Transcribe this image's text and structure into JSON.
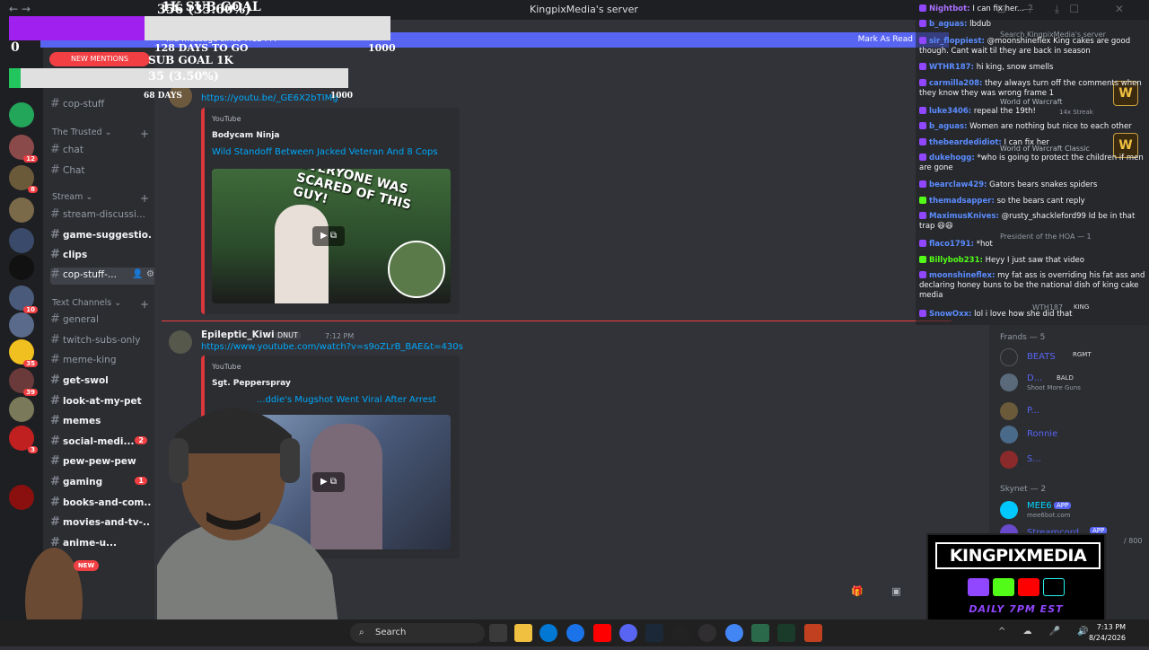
{
  "window": {
    "title": "KingpixMedia's server",
    "nav": "← →",
    "window_controls": "— ☐ ✕",
    "title_icons": "⊟ ? ⤓"
  },
  "sub_goal_1": {
    "title": "1K SUB GOAL",
    "progress_text": "356 (35.60%)",
    "progress_fraction": 0.356,
    "days_to_go": "128 DAYS TO GO",
    "max": "1000",
    "zero": "0"
  },
  "sub_goal_2": {
    "title": "SUB GOAL 1K",
    "progress_text": "35 (3.50%)",
    "progress_fraction": 0.035,
    "days": "68 DAYS",
    "max": "1000"
  },
  "banner": {
    "new_mentions": "NEW MENTIONS",
    "text": "...d message since 7:12 PM",
    "mark_as_read": "Mark As Read"
  },
  "channels": {
    "top": {
      "label": "cop-stuff"
    },
    "cat_trusted": "The Trusted",
    "trusted": [
      {
        "label": "chat"
      },
      {
        "label": "Chat"
      }
    ],
    "cat_stream": "Stream",
    "stream": [
      {
        "label": "stream-discussi..."
      },
      {
        "label": "game-suggestio..."
      },
      {
        "label": "clips"
      },
      {
        "label": "cop-stuff-..."
      }
    ],
    "cat_text": "Text Channels",
    "text": [
      {
        "label": "general"
      },
      {
        "label": "twitch-subs-only"
      },
      {
        "label": "meme-king"
      },
      {
        "label": "get-swol"
      },
      {
        "label": "look-at-my-pet"
      },
      {
        "label": "memes"
      },
      {
        "label": "social-medi...",
        "badge": "2"
      },
      {
        "label": "pew-pew-pew"
      },
      {
        "label": "gaming",
        "badge": "1"
      },
      {
        "label": "books-and-com..."
      },
      {
        "label": "movies-and-tv-..."
      },
      {
        "label": "anime-u..."
      }
    ],
    "new_pill": "NEW"
  },
  "server_badges": [
    "12",
    "8",
    "10",
    "35",
    "39",
    "3"
  ],
  "messages": [
    {
      "link": "https://youtu.be/_GE6X2bTIMg",
      "embed": {
        "provider": "YouTube",
        "author": "Bodycam Ninja",
        "title": "Wild Standoff Between Jacked Veteran And 8 Cops",
        "thumb_text": "EVERYONE WAS SCARED OF THIS GUY!"
      }
    },
    {
      "author": "Epileptic_Kiwi",
      "tag": "DNUT",
      "time": "7:12 PM",
      "link": "https://www.youtube.com/watch?v=s9oZLrB_BAE&t=430s",
      "embed": {
        "provider": "YouTube",
        "author": "Sgt. Pepperspray",
        "title": "...ddie's Mugshot Went Viral After Arrest"
      }
    }
  ],
  "chat": [
    {
      "user": "Nightbot:",
      "text": "I can fix her...",
      "color": "#a970ff"
    },
    {
      "user": "b_aguas:",
      "text": "lbdub",
      "color": "#5b8cff"
    },
    {
      "user": "sir_floppiest:",
      "text": "@moonshineflex King cakes are good though. Cant wait til they are back in season",
      "color": "#5b8cff"
    },
    {
      "user": "WTHR187:",
      "text": "hi king, snow smells",
      "color": "#5b8cff"
    },
    {
      "user": "carmilla208:",
      "text": "they always turn off the comments when they know they was wrong frame 1",
      "color": "#5b8cff"
    },
    {
      "user": "luke3406:",
      "text": "repeal the 19th!",
      "color": "#5b8cff"
    },
    {
      "user": "b_aguas:",
      "text": "Women are nothing but nice to each other",
      "color": "#5b8cff"
    },
    {
      "user": "thebeardedidiot:",
      "text": "I can fix her",
      "color": "#5b8cff"
    },
    {
      "user": "dukehogg:",
      "text": "*who is going to protect the children if men are gone",
      "color": "#5b8cff"
    },
    {
      "user": "bearclaw429:",
      "text": "Gators bears snakes spiders",
      "color": "#5b8cff"
    },
    {
      "user": "themadsapper:",
      "text": "so the bears cant reply",
      "color": "#5b8cff"
    },
    {
      "user": "MaximusKnives:",
      "text": "@rusty_shackleford99 Id be in that trap 😆😆",
      "color": "#5b8cff"
    },
    {
      "user": "flaco1791:",
      "text": "*hot",
      "color": "#5b8cff"
    },
    {
      "user": "Billybob231:",
      "text": "Heyy I just saw that video",
      "color": "#53fc18"
    },
    {
      "user": "moonshineflex:",
      "text": "my fat ass is overriding his fat ass and declaring honey buns to be the national dish of king cake media",
      "color": "#5b8cff"
    },
    {
      "user": "SnowOxx:",
      "text": "lol i love how she did that",
      "color": "#5b8cff"
    }
  ],
  "members": {
    "search_placeholder": "Search KingpixMedia's server",
    "activity_1": "World of Warcraft",
    "activity_1_sub": "14x Streak",
    "activity_2": "World of Warcraft Classic",
    "president": "President of the HOA — 1",
    "cat_frands": "Frands — 5",
    "frands": [
      {
        "name": "BEATS",
        "tag": "RGMT",
        "color": "#5865f2"
      },
      {
        "name": "D...",
        "tag": "BALD",
        "sub": "Shoot More Guns",
        "color": "#5865f2"
      },
      {
        "name": "P...",
        "color": "#5865f2"
      },
      {
        "name": "Ronnie",
        "color": "#5865f2"
      },
      {
        "name": "S...",
        "color": "#5865f2"
      }
    ],
    "cat_skynet": "Skynet — 2",
    "skynet": [
      {
        "name": "MEE6",
        "tag": "APP",
        "sub": "mee6bot.com",
        "color": "#00d4ff"
      },
      {
        "name": "Streamcord",
        "tag": "APP",
        "color": "#5865f2"
      }
    ],
    "wth": "WTH187",
    "king_tag": "KING",
    "chat_count": "/ 800"
  },
  "logo": {
    "title": "KINGPIXMEDIA",
    "sub": "DAILY 7PM EST"
  },
  "taskbar": {
    "search": "Search",
    "time": "7:13 PM",
    "date": "8/24/2026",
    "tray": "^ ☁ 🎤 🔊"
  },
  "composer_icons": "🎁 ▣ ☺"
}
